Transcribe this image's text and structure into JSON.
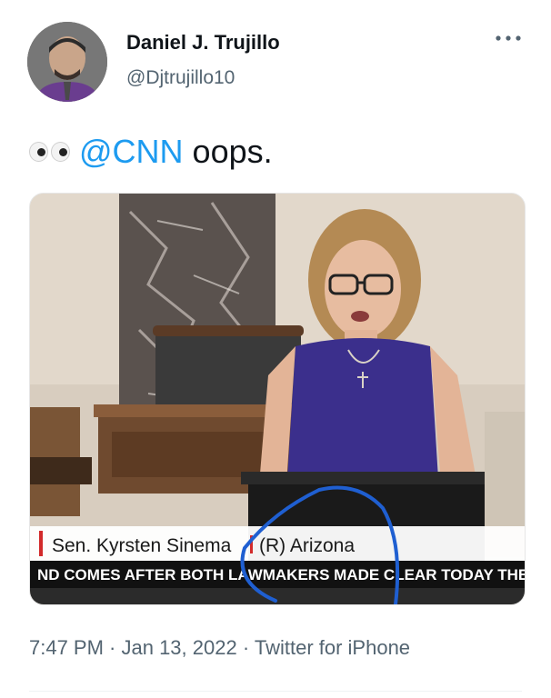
{
  "tweet": {
    "author_name": "Daniel J. Trujillo",
    "author_handle": "@Djtrujillo10",
    "text_mention": "@CNN",
    "text_body": "oops.",
    "emoji_icon": "eyes-emoji-icon",
    "timestamp": "7:47 PM · Jan 13, 2022 · Twitter for iPhone"
  },
  "media": {
    "chyron_name": "Sen. Kyrsten Sinema",
    "chyron_party": "(R) Arizona",
    "ticker": "ND COMES AFTER BOTH LAWMAKERS MADE CLEAR TODAY THEY A"
  },
  "colors": {
    "link": "#1d9bf0",
    "secondary_text": "#536471",
    "annotation_circle": "#1f5fd1",
    "chyron_accent": "#d22a2a"
  }
}
